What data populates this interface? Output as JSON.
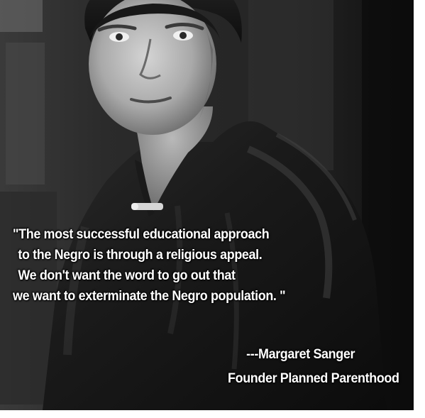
{
  "photo": {
    "subject": "portrait-photo"
  },
  "quote": {
    "line1": "\"The most successful educational approach",
    "line2": "to the Negro is through a religious appeal.",
    "line3": "We don't want the word to go out that",
    "line4": "we want to exterminate the Negro population. \""
  },
  "attribution": {
    "author": "---Margaret Sanger",
    "role": "Founder Planned Parenthood"
  },
  "colors": {
    "text": "#ffffff",
    "frame_border": "#ffffff"
  }
}
